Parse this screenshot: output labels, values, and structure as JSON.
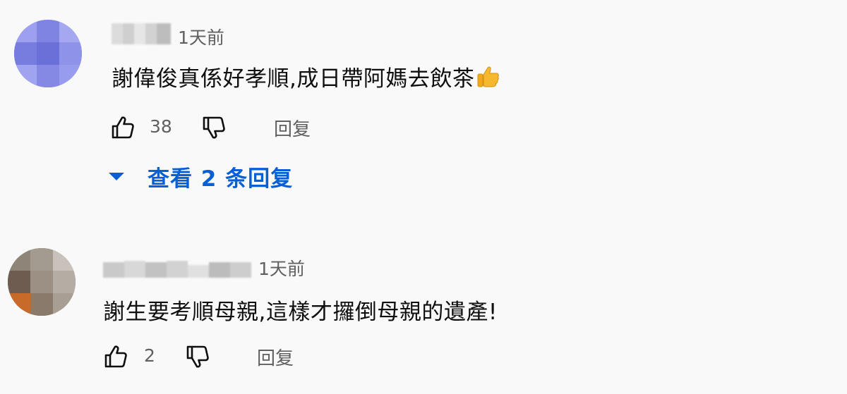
{
  "comments": [
    {
      "time": "1天前",
      "text": "謝偉俊真係好孝順,成日帶阿媽去飲茶",
      "like_count": "38",
      "reply_label": "回复",
      "emoji": "thumbs-up-emoji"
    },
    {
      "time": "1天前",
      "text": "謝生要考順母親,這樣才攞倒母親的遺產!",
      "like_count": "2",
      "reply_label": "回复"
    }
  ],
  "view_replies": {
    "label": "查看 2 条回复",
    "icon": "caret-down-icon"
  },
  "colors": {
    "link_blue": "#065fd4",
    "secondary_text": "#606060",
    "primary_text": "#0f0f0f",
    "background": "#f9f9f9"
  },
  "icons": [
    "like-icon",
    "dislike-icon"
  ]
}
